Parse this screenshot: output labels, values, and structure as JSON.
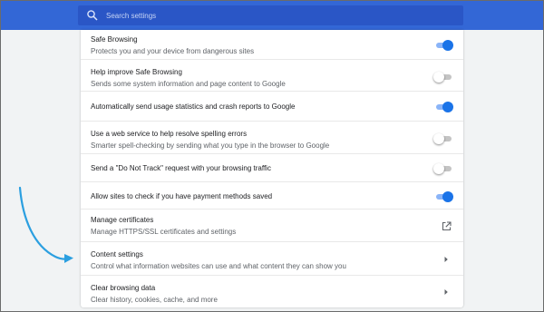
{
  "search": {
    "placeholder": "Search settings"
  },
  "settings": [
    {
      "title": "Safe Browsing",
      "subtitle": "Protects you and your device from dangerous sites",
      "control": "toggle",
      "state": "on"
    },
    {
      "title": "Help improve Safe Browsing",
      "subtitle": "Sends some system information and page content to Google",
      "control": "toggle",
      "state": "off"
    },
    {
      "title": "Automatically send usage statistics and crash reports to Google",
      "control": "toggle",
      "state": "on"
    },
    {
      "title": "Use a web service to help resolve spelling errors",
      "subtitle": "Smarter spell-checking by sending what you type in the browser to Google",
      "control": "toggle",
      "state": "off"
    },
    {
      "title": "Send a \"Do Not Track\" request with your browsing traffic",
      "control": "toggle",
      "state": "off"
    },
    {
      "title": "Allow sites to check if you have payment methods saved",
      "control": "toggle",
      "state": "on"
    },
    {
      "title": "Manage certificates",
      "subtitle": "Manage HTTPS/SSL certificates and settings",
      "control": "external-link-icon"
    },
    {
      "title": "Content settings",
      "subtitle": "Control what information websites can use and what content they can show you",
      "control": "chevron-right-icon"
    },
    {
      "title": "Clear browsing data",
      "subtitle": "Clear history, cookies, cache, and more",
      "control": "chevron-right-icon"
    }
  ],
  "colors": {
    "header": "#3367d6",
    "search_box": "#2a56c6",
    "toggle_on": "#1a73e8",
    "annotation_arrow": "#2b9fe0"
  }
}
